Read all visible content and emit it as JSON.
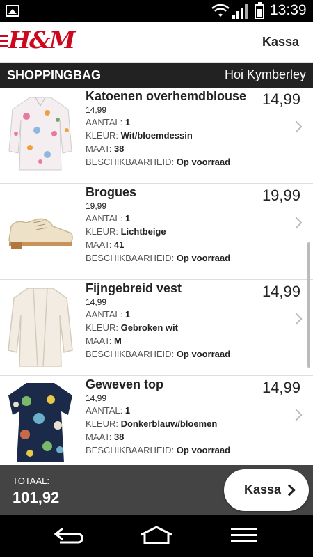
{
  "status_bar": {
    "time": "13:39",
    "icons": [
      "image-notification-icon",
      "wifi-icon",
      "signal-icon",
      "battery-icon"
    ]
  },
  "header": {
    "logo": "H&M",
    "kassa_link": "Kassa"
  },
  "subheader": {
    "behind_text": "BESCHIKBAARHEID: Op voorraad",
    "title": "SHOPPINGBAG",
    "greeting": "Hoi Kymberley"
  },
  "labels": {
    "aantal": "AANTAL:",
    "kleur": "KLEUR:",
    "maat": "MAAT:",
    "beschikbaarheid": "BESCHIKBAARHEID:"
  },
  "items": [
    {
      "name": "Katoenen overhemdblouse",
      "price_small": "14,99",
      "aantal": "1",
      "kleur": "Wit/bloemdessin",
      "maat": "38",
      "beschikbaarheid": "Op voorraad",
      "price": "14,99"
    },
    {
      "name": "Brogues",
      "price_small": "19,99",
      "aantal": "1",
      "kleur": "Lichtbeige",
      "maat": "41",
      "beschikbaarheid": "Op voorraad",
      "price": "19,99"
    },
    {
      "name": "Fijngebreid vest",
      "price_small": "14,99",
      "aantal": "1",
      "kleur": "Gebroken wit",
      "maat": "M",
      "beschikbaarheid": "Op voorraad",
      "price": "14,99"
    },
    {
      "name": "Geweven top",
      "price_small": "14,99",
      "aantal": "1",
      "kleur": "Donkerblauw/bloemen",
      "maat": "38",
      "beschikbaarheid": "Op voorraad",
      "price": "14,99"
    }
  ],
  "total": {
    "label": "TOTAAL:",
    "value": "101,92"
  },
  "checkout_button": {
    "label": "Kassa"
  },
  "nav": [
    "back-icon",
    "home-icon",
    "menu-icon"
  ],
  "colors": {
    "brand": "#cc071e",
    "subheader_bg": "#222222",
    "totalbar_bg": "#444444"
  }
}
